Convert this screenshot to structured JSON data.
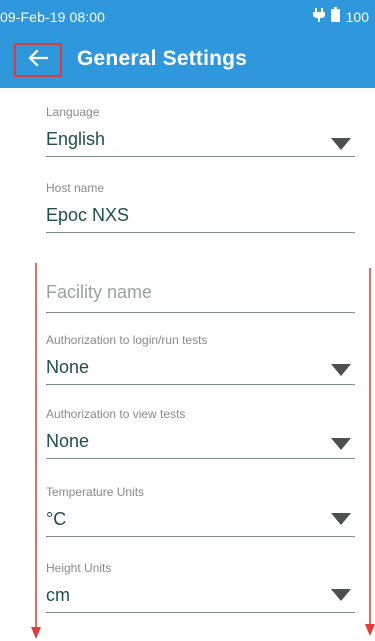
{
  "status_bar": {
    "time": "09-Feb-19 08:00",
    "battery": "100",
    "icons": [
      "charging-plug-icon",
      "battery-icon"
    ]
  },
  "app_bar": {
    "title": "General Settings",
    "back_icon": "arrow-left-icon"
  },
  "settings": {
    "language": {
      "label": "Language",
      "value": "English"
    },
    "host_name": {
      "label": "Host name",
      "value": "Epoc NXS"
    },
    "facility_name": {
      "placeholder": "Facility name"
    },
    "auth_login": {
      "label": "Authorization to login/run tests",
      "value": "None"
    },
    "auth_view": {
      "label": "Authorization to view tests",
      "value": "None"
    },
    "temperature_units": {
      "label": "Temperature Units",
      "value": "°C"
    },
    "height_units": {
      "label": "Height Units",
      "value": "cm"
    }
  },
  "colors": {
    "primary": "#2f97dc",
    "highlight_box": "#e03a3a",
    "annotation_arrow": "#e03a3a",
    "value_text": "#1f4f4c"
  }
}
